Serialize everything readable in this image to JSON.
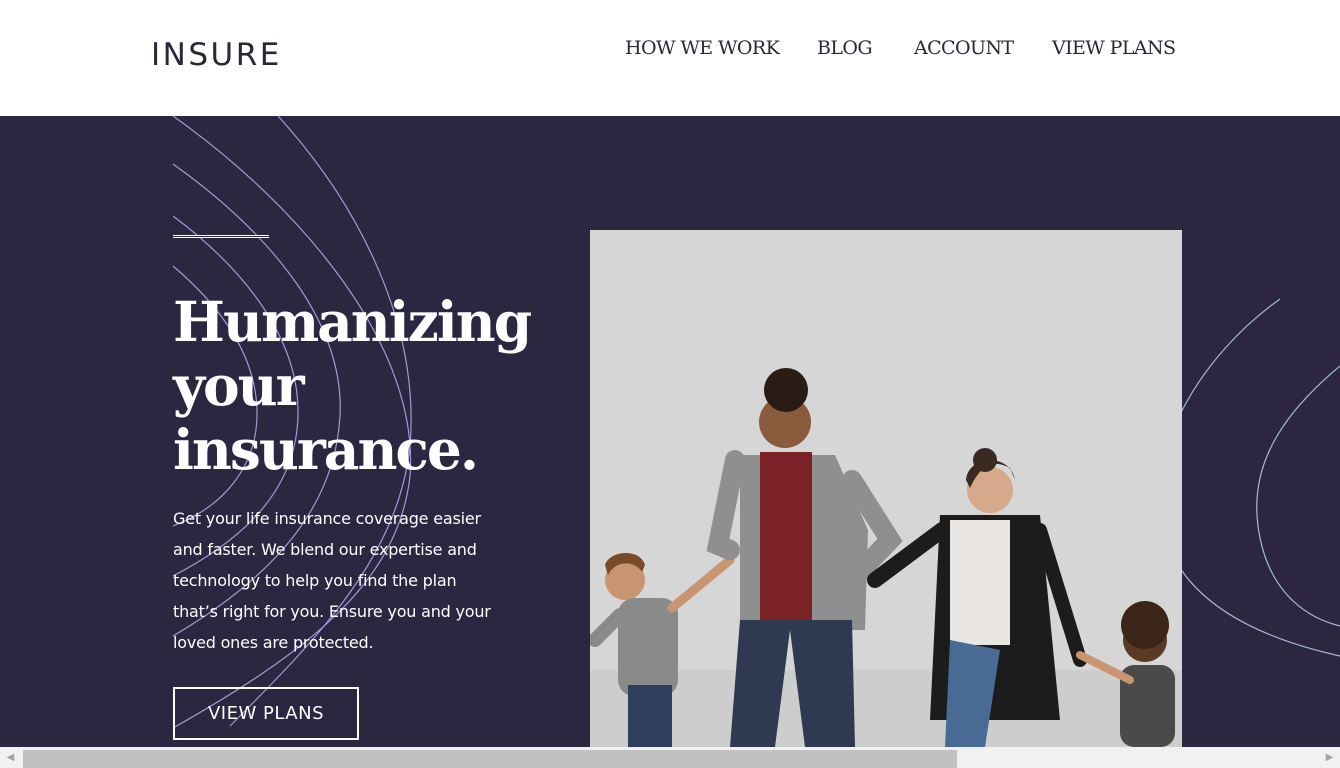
{
  "header": {
    "logo": "INSURE",
    "nav": [
      "HOW WE WORK",
      "BLOG",
      "ACCOUNT",
      "VIEW PLANS"
    ]
  },
  "hero": {
    "headline": [
      "Humanizing",
      "your",
      "insurance."
    ],
    "body": "Get your life insurance coverage easier and faster. We blend our expertise and technology to help you find the plan that’s right for you. Ensure you and your loved ones are protected.",
    "cta": "VIEW PLANS"
  },
  "scrollbar": {
    "left_arrow_icon": "triangle-left-icon",
    "right_arrow_icon": "triangle-right-icon"
  },
  "colors": {
    "hero_bg": "#2d2641",
    "text_dark": "#2b2735",
    "deco_line": "#a29ad6"
  }
}
